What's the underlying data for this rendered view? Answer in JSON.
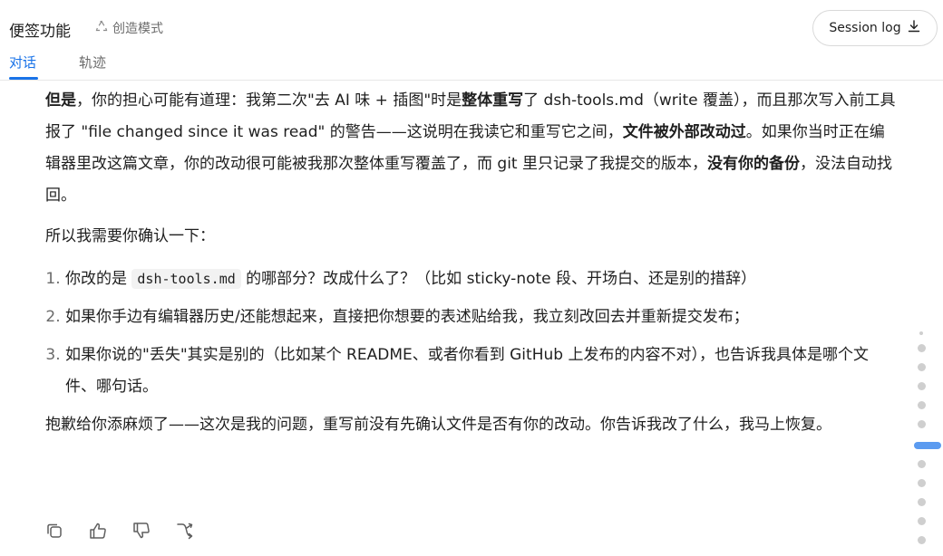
{
  "header": {
    "title": "便签功能",
    "mode_label": "创造模式",
    "session_log_label": "Session log",
    "tabs": [
      {
        "label": "对话",
        "active": true
      },
      {
        "label": "轨迹",
        "active": false
      }
    ]
  },
  "message": {
    "p1": {
      "b1": "但是",
      "t1": "，你的担心可能有道理：我第二次\"去 AI 味 + 插图\"时是",
      "b2": "整体重写",
      "t2": "了 dsh-tools.md（write 覆盖），而且那次写入前工具报了 \"file changed since it was read\" 的警告——这说明在我读它和重写它之间，",
      "b3": "文件被外部改动过",
      "t3": "。如果你当时正在编辑器里改这篇文章，你的改动很可能被我那次整体重写覆盖了，而 git 里只记录了我提交的版本，",
      "b4": "没有你的备份",
      "t4": "，没法自动找回。"
    },
    "p2": "所以我需要你确认一下：",
    "list": {
      "item1_pre": "你改的是 ",
      "item1_code": "dsh-tools.md",
      "item1_post": " 的哪部分？改成什么了？（比如 sticky-note 段、开场白、还是别的措辞）",
      "item2": "如果你手边有编辑器历史/还能想起来，直接把你想要的表述贴给我，我立刻改回去并重新提交发布；",
      "item3": "如果你说的\"丢失\"其实是别的（比如某个 README、或者你看到 GitHub 上发布的内容不对），也告诉我具体是哪个文件、哪句话。"
    },
    "p3": "抱歉给你添麻烦了——这次是我的问题，重写前没有先确认文件是否有你的改动。你告诉我改了什么，我马上恢复。"
  },
  "actions": {
    "icons": [
      "copy-icon",
      "thumbs-up-icon",
      "thumbs-down-icon",
      "branch-icon"
    ]
  },
  "colors": {
    "accent": "#1a73e8",
    "scroll_active": "#5b9bf0",
    "scroll_dot": "#cfcfcf"
  }
}
